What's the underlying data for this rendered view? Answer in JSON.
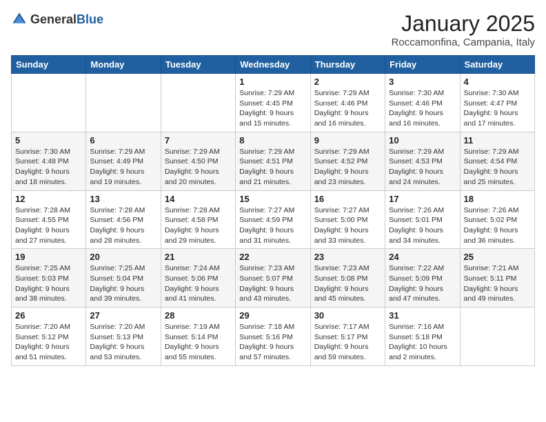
{
  "header": {
    "logo_general": "General",
    "logo_blue": "Blue",
    "month_title": "January 2025",
    "location": "Roccamonfina, Campania, Italy"
  },
  "weekdays": [
    "Sunday",
    "Monday",
    "Tuesday",
    "Wednesday",
    "Thursday",
    "Friday",
    "Saturday"
  ],
  "weeks": [
    [
      {
        "day": "",
        "sunrise": "",
        "sunset": "",
        "daylight": ""
      },
      {
        "day": "",
        "sunrise": "",
        "sunset": "",
        "daylight": ""
      },
      {
        "day": "",
        "sunrise": "",
        "sunset": "",
        "daylight": ""
      },
      {
        "day": "1",
        "sunrise": "Sunrise: 7:29 AM",
        "sunset": "Sunset: 4:45 PM",
        "daylight": "Daylight: 9 hours and 15 minutes."
      },
      {
        "day": "2",
        "sunrise": "Sunrise: 7:29 AM",
        "sunset": "Sunset: 4:46 PM",
        "daylight": "Daylight: 9 hours and 16 minutes."
      },
      {
        "day": "3",
        "sunrise": "Sunrise: 7:30 AM",
        "sunset": "Sunset: 4:46 PM",
        "daylight": "Daylight: 9 hours and 16 minutes."
      },
      {
        "day": "4",
        "sunrise": "Sunrise: 7:30 AM",
        "sunset": "Sunset: 4:47 PM",
        "daylight": "Daylight: 9 hours and 17 minutes."
      }
    ],
    [
      {
        "day": "5",
        "sunrise": "Sunrise: 7:30 AM",
        "sunset": "Sunset: 4:48 PM",
        "daylight": "Daylight: 9 hours and 18 minutes."
      },
      {
        "day": "6",
        "sunrise": "Sunrise: 7:29 AM",
        "sunset": "Sunset: 4:49 PM",
        "daylight": "Daylight: 9 hours and 19 minutes."
      },
      {
        "day": "7",
        "sunrise": "Sunrise: 7:29 AM",
        "sunset": "Sunset: 4:50 PM",
        "daylight": "Daylight: 9 hours and 20 minutes."
      },
      {
        "day": "8",
        "sunrise": "Sunrise: 7:29 AM",
        "sunset": "Sunset: 4:51 PM",
        "daylight": "Daylight: 9 hours and 21 minutes."
      },
      {
        "day": "9",
        "sunrise": "Sunrise: 7:29 AM",
        "sunset": "Sunset: 4:52 PM",
        "daylight": "Daylight: 9 hours and 23 minutes."
      },
      {
        "day": "10",
        "sunrise": "Sunrise: 7:29 AM",
        "sunset": "Sunset: 4:53 PM",
        "daylight": "Daylight: 9 hours and 24 minutes."
      },
      {
        "day": "11",
        "sunrise": "Sunrise: 7:29 AM",
        "sunset": "Sunset: 4:54 PM",
        "daylight": "Daylight: 9 hours and 25 minutes."
      }
    ],
    [
      {
        "day": "12",
        "sunrise": "Sunrise: 7:28 AM",
        "sunset": "Sunset: 4:55 PM",
        "daylight": "Daylight: 9 hours and 27 minutes."
      },
      {
        "day": "13",
        "sunrise": "Sunrise: 7:28 AM",
        "sunset": "Sunset: 4:56 PM",
        "daylight": "Daylight: 9 hours and 28 minutes."
      },
      {
        "day": "14",
        "sunrise": "Sunrise: 7:28 AM",
        "sunset": "Sunset: 4:58 PM",
        "daylight": "Daylight: 9 hours and 29 minutes."
      },
      {
        "day": "15",
        "sunrise": "Sunrise: 7:27 AM",
        "sunset": "Sunset: 4:59 PM",
        "daylight": "Daylight: 9 hours and 31 minutes."
      },
      {
        "day": "16",
        "sunrise": "Sunrise: 7:27 AM",
        "sunset": "Sunset: 5:00 PM",
        "daylight": "Daylight: 9 hours and 33 minutes."
      },
      {
        "day": "17",
        "sunrise": "Sunrise: 7:26 AM",
        "sunset": "Sunset: 5:01 PM",
        "daylight": "Daylight: 9 hours and 34 minutes."
      },
      {
        "day": "18",
        "sunrise": "Sunrise: 7:26 AM",
        "sunset": "Sunset: 5:02 PM",
        "daylight": "Daylight: 9 hours and 36 minutes."
      }
    ],
    [
      {
        "day": "19",
        "sunrise": "Sunrise: 7:25 AM",
        "sunset": "Sunset: 5:03 PM",
        "daylight": "Daylight: 9 hours and 38 minutes."
      },
      {
        "day": "20",
        "sunrise": "Sunrise: 7:25 AM",
        "sunset": "Sunset: 5:04 PM",
        "daylight": "Daylight: 9 hours and 39 minutes."
      },
      {
        "day": "21",
        "sunrise": "Sunrise: 7:24 AM",
        "sunset": "Sunset: 5:06 PM",
        "daylight": "Daylight: 9 hours and 41 minutes."
      },
      {
        "day": "22",
        "sunrise": "Sunrise: 7:23 AM",
        "sunset": "Sunset: 5:07 PM",
        "daylight": "Daylight: 9 hours and 43 minutes."
      },
      {
        "day": "23",
        "sunrise": "Sunrise: 7:23 AM",
        "sunset": "Sunset: 5:08 PM",
        "daylight": "Daylight: 9 hours and 45 minutes."
      },
      {
        "day": "24",
        "sunrise": "Sunrise: 7:22 AM",
        "sunset": "Sunset: 5:09 PM",
        "daylight": "Daylight: 9 hours and 47 minutes."
      },
      {
        "day": "25",
        "sunrise": "Sunrise: 7:21 AM",
        "sunset": "Sunset: 5:11 PM",
        "daylight": "Daylight: 9 hours and 49 minutes."
      }
    ],
    [
      {
        "day": "26",
        "sunrise": "Sunrise: 7:20 AM",
        "sunset": "Sunset: 5:12 PM",
        "daylight": "Daylight: 9 hours and 51 minutes."
      },
      {
        "day": "27",
        "sunrise": "Sunrise: 7:20 AM",
        "sunset": "Sunset: 5:13 PM",
        "daylight": "Daylight: 9 hours and 53 minutes."
      },
      {
        "day": "28",
        "sunrise": "Sunrise: 7:19 AM",
        "sunset": "Sunset: 5:14 PM",
        "daylight": "Daylight: 9 hours and 55 minutes."
      },
      {
        "day": "29",
        "sunrise": "Sunrise: 7:18 AM",
        "sunset": "Sunset: 5:16 PM",
        "daylight": "Daylight: 9 hours and 57 minutes."
      },
      {
        "day": "30",
        "sunrise": "Sunrise: 7:17 AM",
        "sunset": "Sunset: 5:17 PM",
        "daylight": "Daylight: 9 hours and 59 minutes."
      },
      {
        "day": "31",
        "sunrise": "Sunrise: 7:16 AM",
        "sunset": "Sunset: 5:18 PM",
        "daylight": "Daylight: 10 hours and 2 minutes."
      },
      {
        "day": "",
        "sunrise": "",
        "sunset": "",
        "daylight": ""
      }
    ]
  ]
}
